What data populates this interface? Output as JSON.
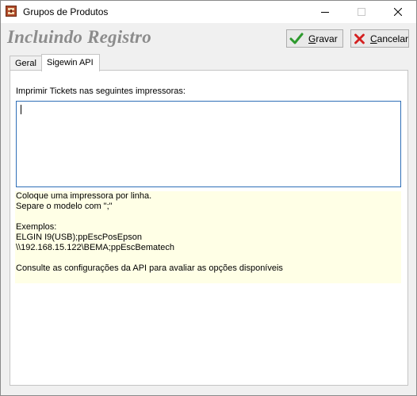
{
  "window": {
    "title": "Grupos de Produtos",
    "icon": "app-icon",
    "controls": [
      "minimize-icon",
      "maximize-icon",
      "close-icon"
    ]
  },
  "header": {
    "title": "Incluindo Registro"
  },
  "toolbar": {
    "save": {
      "prefix": "",
      "hotkey": "G",
      "rest": "ravar",
      "icon": "checkmark-icon"
    },
    "cancel": {
      "prefix": "",
      "hotkey": "C",
      "rest": "ancelar",
      "icon": "x-cancel-icon"
    }
  },
  "tabs": [
    {
      "label": "Geral",
      "active": false
    },
    {
      "label": "Sigewin API",
      "active": true
    }
  ],
  "panel": {
    "printers_label": "Imprimir Tickets nas seguintes impressoras:",
    "printers_value": "",
    "info_lines": [
      "Coloque uma impressora por linha.",
      "Separe o modelo com \";\"",
      "",
      "Exemplos:",
      "ELGIN I9(USB);ppEscPosEpson",
      "\\\\192.168.15.122\\BEMA;ppEscBematech",
      "",
      "Consulte as configurações da API para avaliar as opções disponíveis"
    ]
  },
  "colors": {
    "info_background": "#ffffe6",
    "textarea_border": "#2f6fb7",
    "header_title": "#8c8c8c"
  }
}
